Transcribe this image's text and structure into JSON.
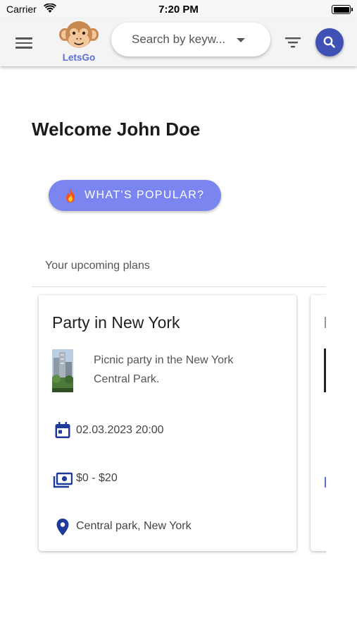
{
  "status_bar": {
    "carrier": "Carrier",
    "time": "7:20 PM",
    "wifi_icon": "wifi-icon",
    "battery_icon": "battery-icon"
  },
  "app_bar": {
    "menu_icon": "menu-icon",
    "logo_text": "LetsGo",
    "search_placeholder": "Search by keyw...",
    "filter_icon": "filter-icon",
    "search_icon": "search-icon",
    "accent_color": "#3f51b5"
  },
  "main": {
    "welcome": "Welcome John Doe",
    "popular_button": {
      "label": "WHAT'S POPULAR?",
      "icon": "fire-icon",
      "color": "#7b85f0"
    },
    "section_label": "Your upcoming plans"
  },
  "plans": [
    {
      "title": "Party in New York",
      "description": "Picnic party in the New York Central Park.",
      "datetime": "02.03.2023 20:00",
      "price": "$0 - $20",
      "location": "Central park, New York",
      "icon_color": "#1e3a9a"
    }
  ]
}
